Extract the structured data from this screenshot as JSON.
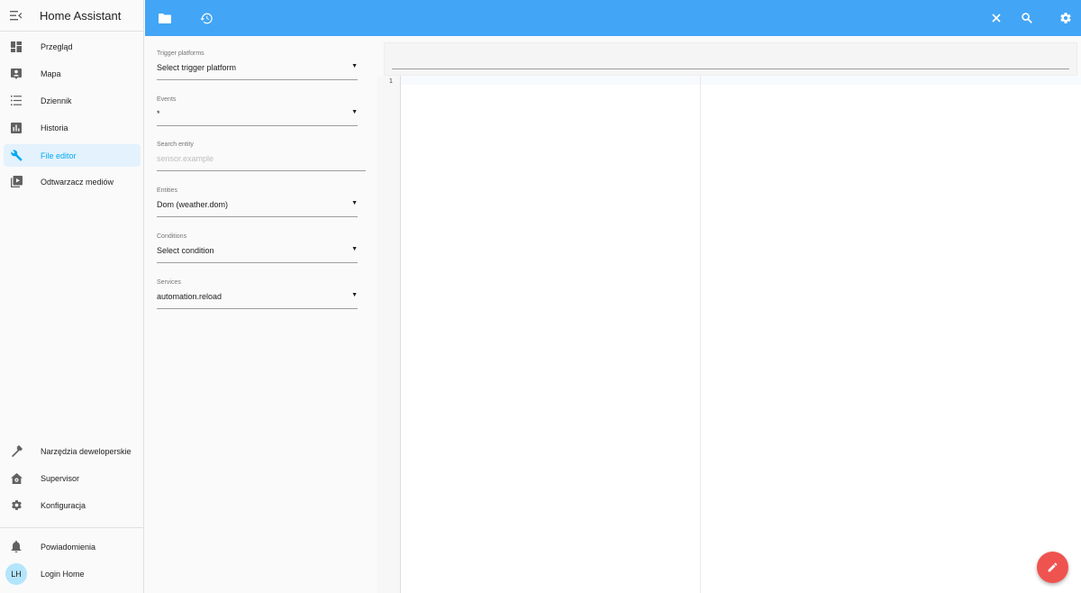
{
  "app": {
    "title": "Home Assistant"
  },
  "sidebar": {
    "items": [
      {
        "label": "Przegląd",
        "icon": "dashboard-icon"
      },
      {
        "label": "Mapa",
        "icon": "map-account-icon"
      },
      {
        "label": "Dziennik",
        "icon": "logbook-list-icon"
      },
      {
        "label": "Historia",
        "icon": "history-chart-icon"
      },
      {
        "label": "File editor",
        "icon": "wrench-icon",
        "active": true
      },
      {
        "label": "Odtwarzacz mediów",
        "icon": "media-player-icon"
      }
    ],
    "bottom_items": [
      {
        "label": "Narzędzia deweloperskie",
        "icon": "hammer-icon"
      },
      {
        "label": "Supervisor",
        "icon": "supervisor-home-icon"
      },
      {
        "label": "Konfiguracja",
        "icon": "gear-icon"
      }
    ],
    "notifications_label": "Powiadomienia",
    "user": {
      "initials": "LH",
      "name": "Login Home"
    }
  },
  "form": {
    "trigger": {
      "label": "Trigger platforms",
      "value": "Select trigger platform"
    },
    "events": {
      "label": "Events",
      "value": "*"
    },
    "search_entity": {
      "label": "Search entity",
      "placeholder": "sensor.example"
    },
    "entities": {
      "label": "Entities",
      "value": "Dom (weather.dom)"
    },
    "conditions": {
      "label": "Conditions",
      "value": "Select condition"
    },
    "services": {
      "label": "Services",
      "value": "automation.reload"
    }
  },
  "editor": {
    "line_number": "1"
  },
  "colors": {
    "toolbar": "#42a5f5",
    "accent": "#03a9f4",
    "fab": "#ef5350"
  }
}
